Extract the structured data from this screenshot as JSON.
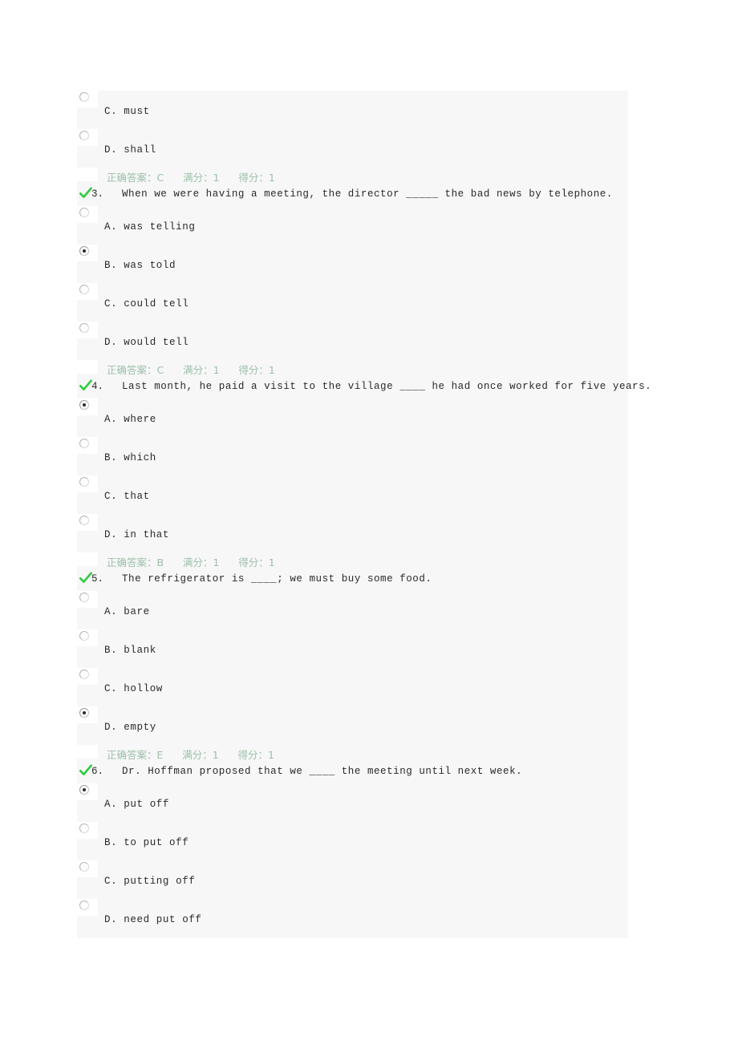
{
  "panel": {
    "background_color": "#f7f7f8",
    "answer_text_color": "#9cc0a8",
    "check_icon_color": "#2ecc40"
  },
  "blocks": [
    {
      "type": "option",
      "name": "option-q2-c",
      "selected": false,
      "label": "C. must"
    },
    {
      "type": "option",
      "name": "option-q2-d",
      "selected": false,
      "label": "D. shall"
    },
    {
      "type": "answer",
      "name": "answer-summary-q2",
      "text": "正确答案：C      满分：1      得分：1"
    },
    {
      "type": "question",
      "name": "question-3",
      "icon": "check-icon",
      "number": "3.",
      "text": "When we were having a meeting, the director _____ the bad news by telephone."
    },
    {
      "type": "option",
      "name": "option-q3-a",
      "selected": false,
      "label": "A. was telling"
    },
    {
      "type": "option",
      "name": "option-q3-b",
      "selected": true,
      "label": "B. was told"
    },
    {
      "type": "option",
      "name": "option-q3-c",
      "selected": false,
      "label": "C. could tell"
    },
    {
      "type": "option",
      "name": "option-q3-d",
      "selected": false,
      "label": "D. would tell"
    },
    {
      "type": "answer",
      "name": "answer-summary-q3",
      "text": "正确答案：C      满分：1      得分：1"
    },
    {
      "type": "question",
      "name": "question-4",
      "icon": "check-icon",
      "number": "4.",
      "text": "Last month, he paid a visit to the village ____ he had once worked for five years."
    },
    {
      "type": "option",
      "name": "option-q4-a",
      "selected": true,
      "label": "A. where"
    },
    {
      "type": "option",
      "name": "option-q4-b",
      "selected": false,
      "label": "B. which"
    },
    {
      "type": "option",
      "name": "option-q4-c",
      "selected": false,
      "label": "C. that"
    },
    {
      "type": "option",
      "name": "option-q4-d",
      "selected": false,
      "label": "D. in that"
    },
    {
      "type": "answer",
      "name": "answer-summary-q4",
      "text": "正确答案：B      满分：1      得分：1"
    },
    {
      "type": "question",
      "name": "question-5",
      "icon": "check-icon",
      "number": "5.",
      "text": "The refrigerator is ____; we must buy some food."
    },
    {
      "type": "option",
      "name": "option-q5-a",
      "selected": false,
      "label": "A. bare"
    },
    {
      "type": "option",
      "name": "option-q5-b",
      "selected": false,
      "label": "B. blank"
    },
    {
      "type": "option",
      "name": "option-q5-c",
      "selected": false,
      "label": "C. hollow"
    },
    {
      "type": "option",
      "name": "option-q5-d",
      "selected": true,
      "label": "D. empty"
    },
    {
      "type": "answer",
      "name": "answer-summary-q5",
      "text": "正确答案：E      满分：1      得分：1"
    },
    {
      "type": "question",
      "name": "question-6",
      "icon": "check-icon",
      "number": "6.",
      "text": "Dr. Hoffman proposed that we ____ the meeting until next week."
    },
    {
      "type": "option",
      "name": "option-q6-a",
      "selected": true,
      "label": "A. put off"
    },
    {
      "type": "option",
      "name": "option-q6-b",
      "selected": false,
      "label": "B. to put off"
    },
    {
      "type": "option",
      "name": "option-q6-c",
      "selected": false,
      "label": "C. putting off"
    },
    {
      "type": "option",
      "name": "option-q6-d",
      "selected": false,
      "label": "D. need put off"
    }
  ]
}
